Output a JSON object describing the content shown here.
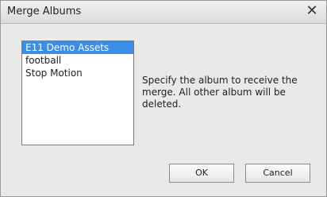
{
  "window": {
    "title": "Merge Albums",
    "close_glyph": "✕",
    "close_icon": "close-icon"
  },
  "albums": {
    "items": [
      {
        "label": "E11 Demo Assets",
        "selected": true
      },
      {
        "label": "football",
        "selected": false
      },
      {
        "label": "Stop Motion",
        "selected": false
      }
    ]
  },
  "message": "Specify the album to receive the merge. All other album will be deleted.",
  "buttons": {
    "ok_label": "OK",
    "cancel_label": "Cancel"
  },
  "colors": {
    "selection": "#3a8ee6",
    "dialog_bg": "#e9e9e9"
  }
}
